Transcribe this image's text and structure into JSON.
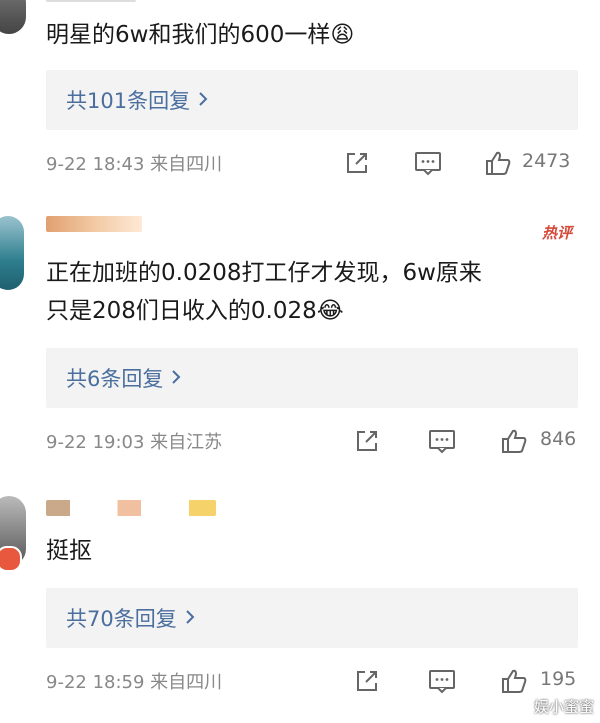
{
  "comments": [
    {
      "text": "明星的6w和我们的600一样😩",
      "replies_label": "共101条回复",
      "meta": "9-22 18:43 来自四川",
      "likes": "2473"
    },
    {
      "text_line1": "正在加班的0.0208打工仔才发现，6w原来",
      "text_line2": "只是208们日收入的0.028😂",
      "hot_label": "热评",
      "replies_label": "共6条回复",
      "meta": "9-22 19:03 来自江苏",
      "likes": "846"
    },
    {
      "text": "挺抠",
      "replies_label": "共70条回复",
      "meta": "9-22 18:59 来自四川",
      "likes": "195"
    }
  ],
  "watermark": "娱小蜜蜜",
  "icons": [
    "share-icon",
    "comment-icon",
    "like-icon",
    "chevron-right-icon"
  ]
}
